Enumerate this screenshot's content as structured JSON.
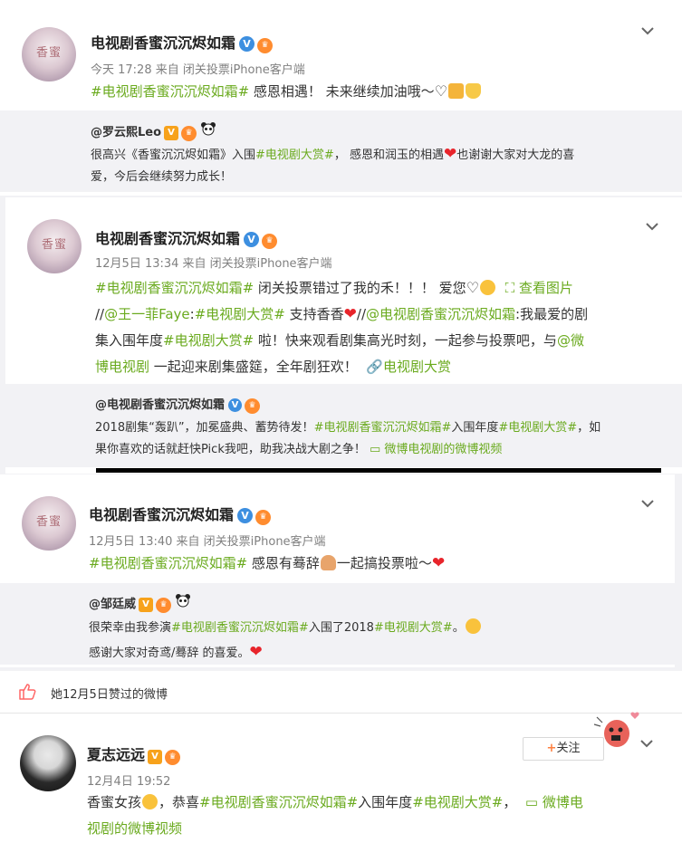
{
  "post1": {
    "author": "电视剧香蜜沉沉烬如霜",
    "meta": "今天 17:28 来自 闭关投票iPhone客户端",
    "tag": "#电视剧香蜜沉沉烬如霜#",
    "text": " 感恩相遇！ 未来继续加油哦～",
    "repost": {
      "author": "@罗云熙Leo",
      "line1_a": "很高兴《香蜜沉沉烬如霜》入围",
      "line1_tag": "#电视剧大赏#",
      "line1_b": "， 感恩和润玉的相遇",
      "line1_c": "也谢谢大家对大龙的喜",
      "line2": "爱，今后会继续努力成长！"
    }
  },
  "post2": {
    "author": "电视剧香蜜沉沉烬如霜",
    "meta": "12月5日 13:34 来自 闭关投票iPhone客户端",
    "tag1": "#电视剧香蜜沉沉烬如霜#",
    "text1": " 闭关投票错过了我的禾！！！ 爱您",
    "view_image": "查看图片",
    "prefix2": "//",
    "at1": "@王一菲Faye",
    "colon": ":",
    "tag2": "#电视剧大赏#",
    "text2": " 支持香香",
    "slash2": "//",
    "at2": "@电视剧香蜜沉沉烬如霜",
    "text3": ":我最爱的剧",
    "text4": "集入围年度",
    "tag3": "#电视剧大赏#",
    "text5": " 啦！快来观看剧集高光时刻，一起参与投票吧，与",
    "at3a": "@微",
    "at3b": "博电视剧",
    "text6": " 一起迎来剧集盛筵，全年剧狂欢！",
    "link": "电视剧大赏",
    "repost": {
      "author": "@电视剧香蜜沉沉烬如霜",
      "line1_a": "2018剧集“轰趴”，加冕盛典、蓄势待发！",
      "line1_tag1": "#电视剧香蜜沉沉烬如霜#",
      "line1_b": "入围年度",
      "line1_tag2": "#电视剧大赏#",
      "line1_c": "，如",
      "line2_a": "果你喜欢的话就赶快Pick我吧，助我决战大剧之争！",
      "line2_link": "微博电视剧的微博视频"
    }
  },
  "post3": {
    "author": "电视剧香蜜沉沉烬如霜",
    "meta": "12月5日 13:40 来自 闭关投票iPhone客户端",
    "tag": "#电视剧香蜜沉沉烬如霜#",
    "text_a": " 感恩有蓦辞",
    "text_b": "一起搞投票啦～",
    "repost": {
      "author": "@邹廷威",
      "line1_a": "很荣幸由我参演",
      "line1_tag1": "#电视剧香蜜沉沉烬如霜#",
      "line1_b": "入围了2018",
      "line1_tag2": "#电视剧大赏#",
      "line1_c": "。",
      "line2": "感谢大家对奇鸢/蓦辞 的喜爱。"
    }
  },
  "like_notice": "她12月5日赞过的微博",
  "post4": {
    "author": "夏志远远",
    "meta": "12月4日 19:52",
    "follow": "关注",
    "text_a": "香蜜女孩",
    "text_b": "，恭喜",
    "tag1": "#电视剧香蜜沉沉烬如霜#",
    "text_c": "入围年度",
    "tag2": "#电视剧大赏#",
    "text_d": "，",
    "link_a": "微博电",
    "link_b": "视剧的微博视频"
  },
  "colors": {
    "accent_green": "#6aaa1e",
    "verified_blue": "#3d8fe0",
    "heart_red": "#e8242b",
    "background": "#f2f2f5"
  }
}
